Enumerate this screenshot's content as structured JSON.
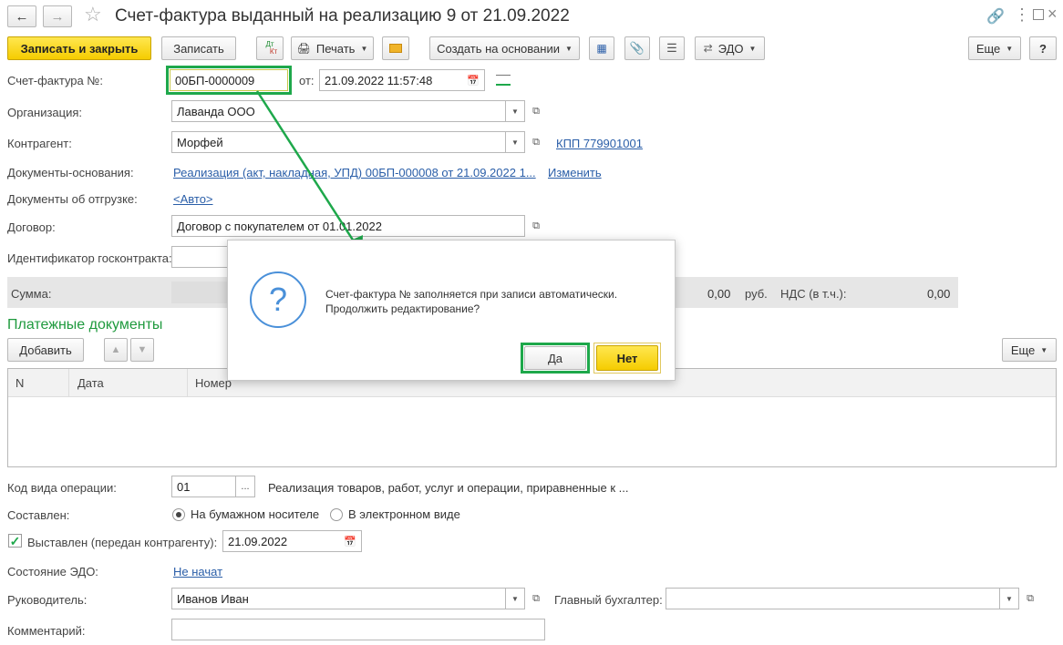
{
  "window": {
    "title": "Счет-фактура выданный на реализацию 9 от 21.09.2022"
  },
  "toolbar": {
    "save_close": "Записать и закрыть",
    "save": "Записать",
    "dtkt_top": "Дт",
    "dtkt_bottom": "Кт",
    "print": "Печать",
    "create_based": "Создать на основании",
    "edo": "ЭДО",
    "more": "Еще",
    "help": "?"
  },
  "form": {
    "number_label": "Счет-фактура №:",
    "number_value": "00БП-0000009",
    "date_label": "от:",
    "date_value": "21.09.2022 11:57:48",
    "org_label": "Организация:",
    "org_value": "Лаванда ООО",
    "contractor_label": "Контрагент:",
    "contractor_value": "Морфей",
    "kpp_link": "КПП 779901001",
    "basis_label": "Документы-основания:",
    "basis_link": "Реализация (акт, накладная, УПД) 00БП-000008 от 21.09.2022 1...",
    "change_link": "Изменить",
    "shipment_label": "Документы об отгрузке:",
    "shipment_link": "<Авто>",
    "contract_label": "Договор:",
    "contract_value": "Договор с покупателем от 01.01.2022",
    "gov_label": "Идентификатор госконтракта:",
    "sum_label": "Сумма:",
    "sum_value": "0,00",
    "currency": "руб.",
    "vat_label": "НДС (в т.ч.):",
    "vat_value": "0,00"
  },
  "payments": {
    "title": "Платежные документы",
    "add": "Добавить",
    "more": "Еще",
    "columns": [
      "N",
      "Дата",
      "Номер"
    ]
  },
  "bottom": {
    "opcode_label": "Код вида операции:",
    "opcode_value": "01",
    "opcode_desc": "Реализация товаров, работ, услуг и операции, приравненные к ...",
    "composed_label": "Составлен:",
    "paper": "На бумажном носителе",
    "electronic": "В электронном виде",
    "issued_label": "Выставлен (передан контрагенту):",
    "issued_date": "21.09.2022",
    "edo_state_label": "Состояние ЭДО:",
    "edo_state_link": "Не начат",
    "head_label": "Руководитель:",
    "head_value": "Иванов Иван",
    "accountant_label": "Главный бухгалтер:",
    "comment_label": "Комментарий:"
  },
  "dialog": {
    "line1": "Счет-фактура № заполняется при записи автоматически.",
    "line2": "Продолжить редактирование?",
    "yes": "Да",
    "no": "Нет"
  },
  "colors": {
    "accent_green": "#1ea84b",
    "yellow": "#f5cc00",
    "link": "#2a5ea8",
    "section_title": "#1f9a3e"
  }
}
